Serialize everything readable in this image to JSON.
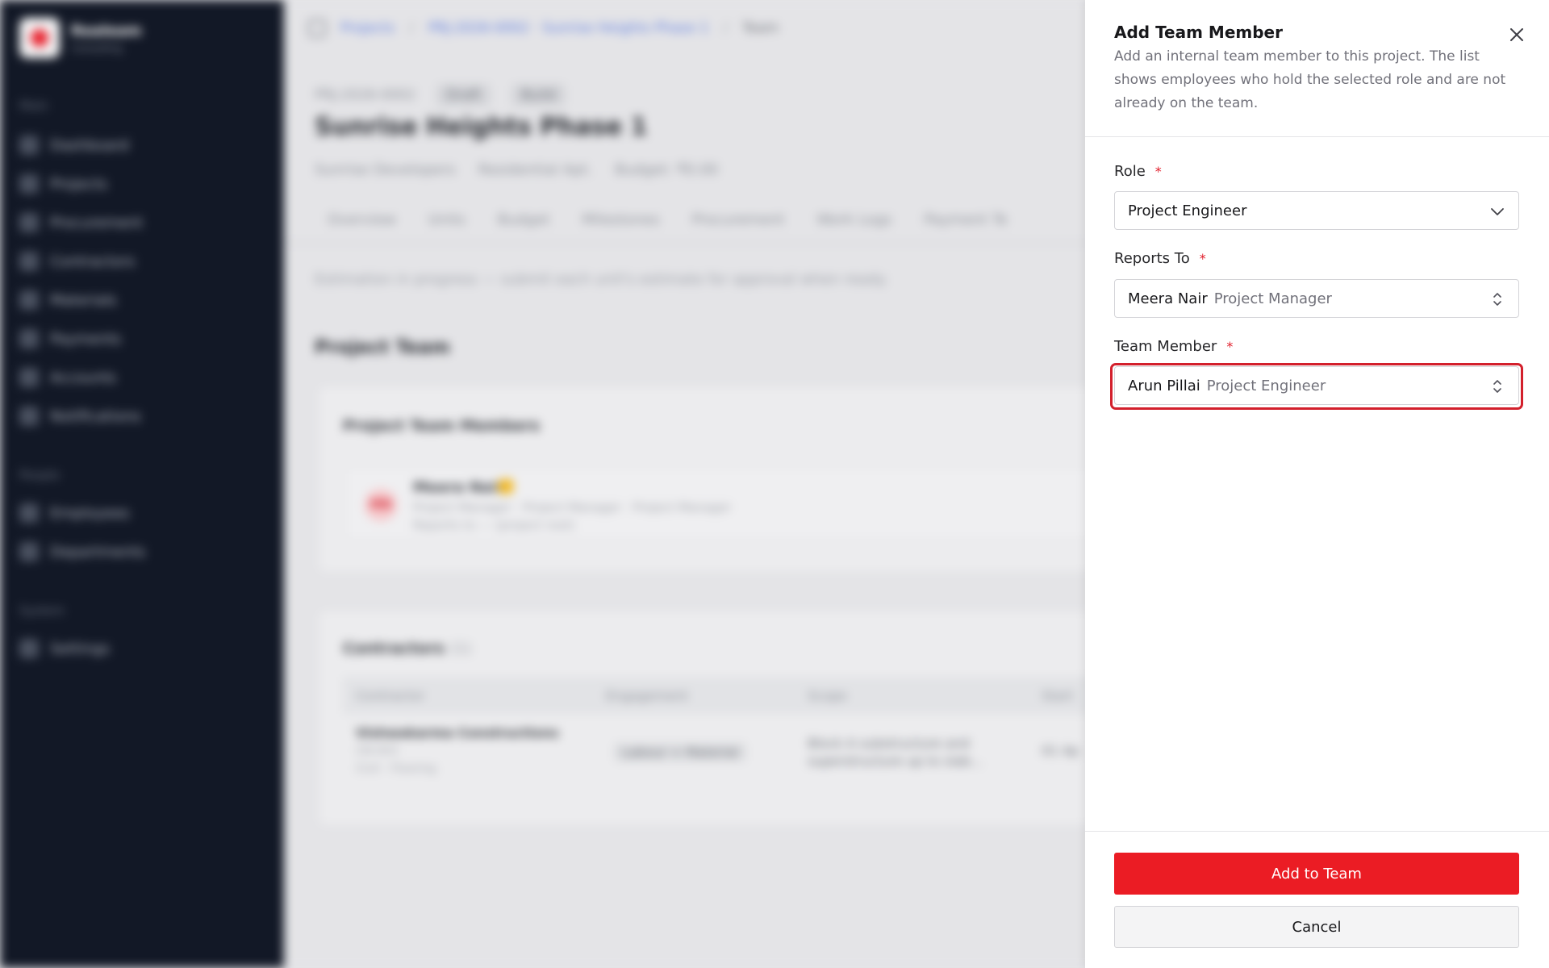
{
  "background": {
    "brand": {
      "name": "Realeam",
      "sub": "Consulting",
      "logo_icon": "brand-logo-icon"
    },
    "sidebar": {
      "sections": [
        {
          "label": "Main",
          "items": [
            "Dashboard",
            "Projects",
            "Procurement",
            "Contractors",
            "Materials",
            "Payments",
            "Accounts",
            "Notifications"
          ]
        },
        {
          "label": "People",
          "items": [
            "Employees",
            "Departments"
          ]
        },
        {
          "label": "System",
          "items": [
            "Settings"
          ]
        }
      ]
    },
    "breadcrumb": {
      "root": "Projects",
      "project": "PRJ-2026-0002 · Sunrise Heights Phase 1",
      "current": "Team"
    },
    "project": {
      "code": "PRJ-2026-0002",
      "status": "Draft",
      "tag": "Build",
      "title": "Sunrise Heights Phase 1",
      "client": "Sunrise Developers",
      "type": "Residential Apt.",
      "budget": "Budget: ₹0.00"
    },
    "tabs": [
      "Overview",
      "Units",
      "Budget",
      "Milestones",
      "Procurement",
      "Work Logs",
      "Payment Te"
    ],
    "notice": "Estimation in progress — submit each unit's estimate for approval when ready.",
    "team_section_title": "Project Team",
    "team_card": {
      "title": "Project Team Members",
      "member": {
        "initials": "MN",
        "name": "Meera Nair",
        "line1": "Project Manager · Project Manager · Project Manager",
        "line2": "Reports to — (project root)"
      }
    },
    "contractors": {
      "title": "Contractors",
      "count": "(1)",
      "columns": [
        "Contractor",
        "Engagement",
        "Scope",
        "Start"
      ],
      "row": {
        "name": "Vishwakarma Constructions",
        "id": "CN-003",
        "kind": "Civil · Flooring",
        "engagement": "Labour + Material",
        "scope": "Block A substructure and superstructure up to slab...",
        "start": "01 Ap"
      }
    }
  },
  "drawer": {
    "title": "Add Team Member",
    "description": "Add an internal team member to this project. The list shows employees who hold the selected role and are not already on the team.",
    "close_icon": "close-icon",
    "required_mark": "*",
    "fields": {
      "role": {
        "label": "Role",
        "value": "Project Engineer"
      },
      "reports_to": {
        "label": "Reports To",
        "value_name": "Meera Nair",
        "value_role": "Project Manager"
      },
      "team_member": {
        "label": "Team Member",
        "value_name": "Arun Pillai",
        "value_role": "Project Engineer"
      }
    },
    "primary_button": "Add to Team",
    "secondary_button": "Cancel"
  },
  "colors": {
    "accent": "#eb1c24",
    "focus_ring": "#d3202c",
    "sidebar_bg": "#121826"
  }
}
